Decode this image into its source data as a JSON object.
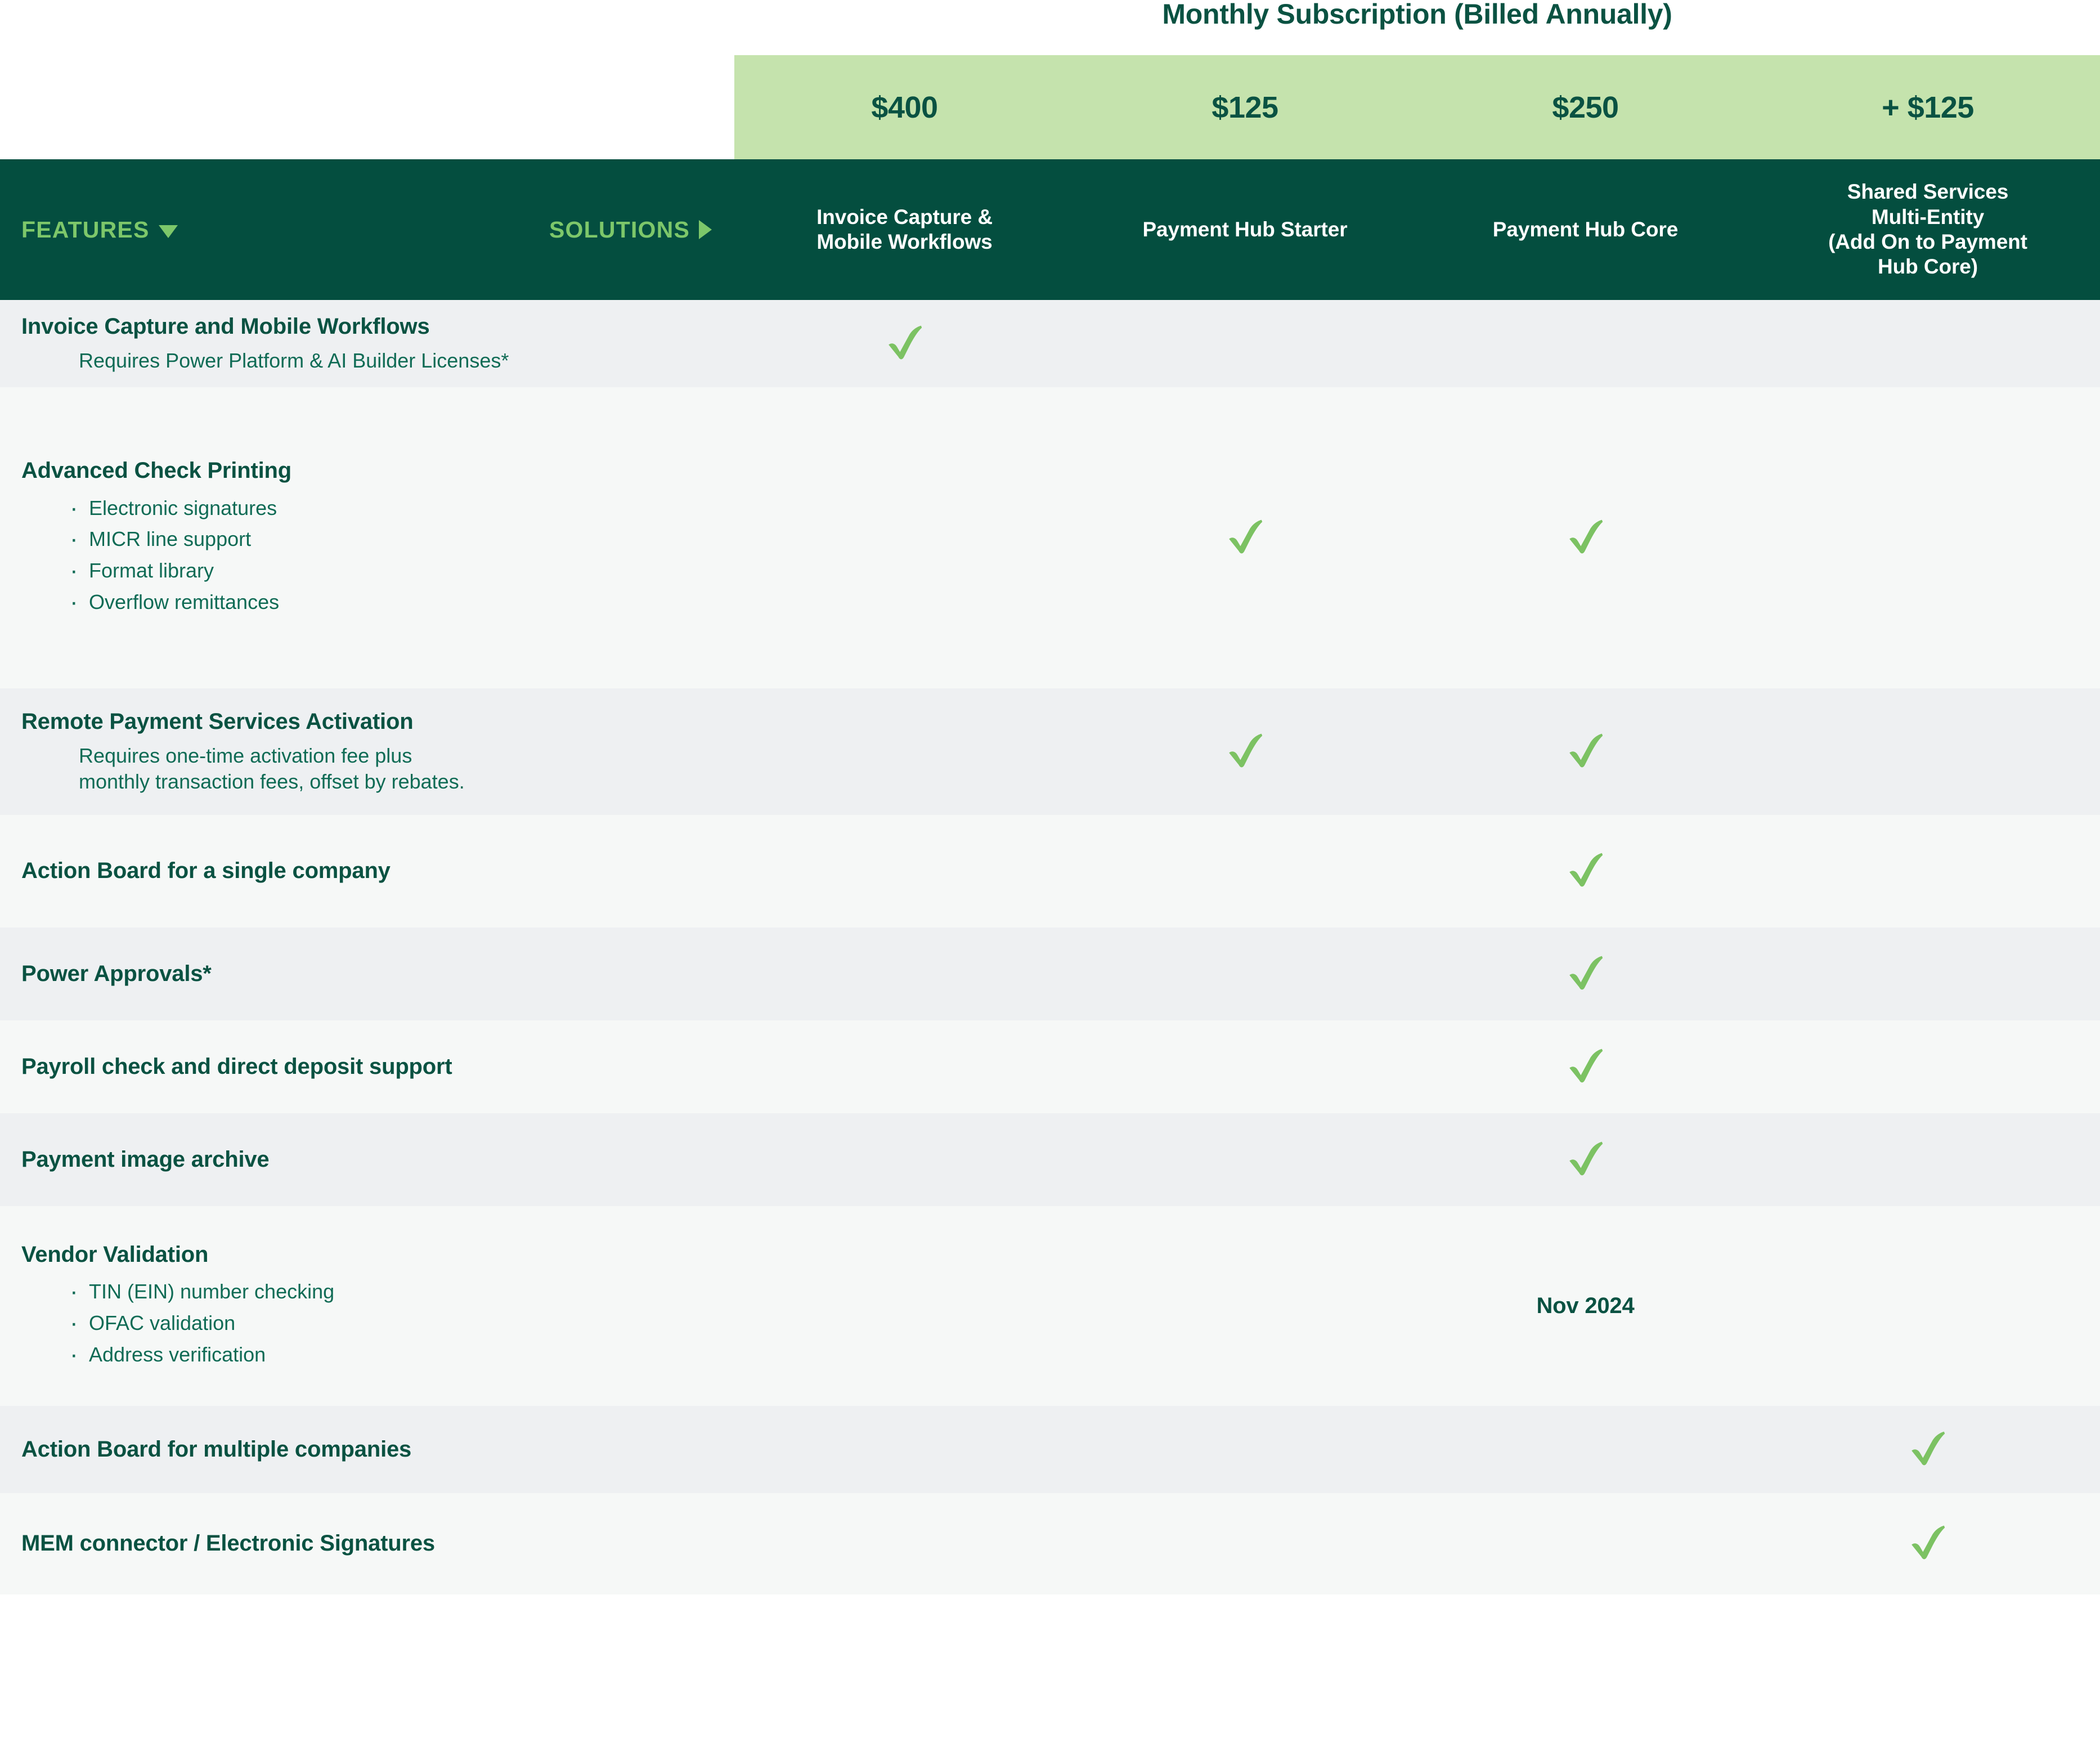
{
  "header": {
    "title": "Monthly Subscription (Billed Annually)",
    "features_label": "FEATURES",
    "solutions_label": "SOLUTIONS",
    "features_icon": "chevron-down-icon",
    "solutions_icon": "chevron-right-icon"
  },
  "colors": {
    "dark_green": "#044e3f",
    "title_green": "#0a5242",
    "light_green_band": "#c5e3ad",
    "accent_green": "#7dc76a",
    "check_green": "#7cc263",
    "row_gray": "#eef0f2",
    "row_white": "#f6f8f7"
  },
  "columns": [
    {
      "id": "invoice-capture",
      "price": "$400",
      "name": "Invoice Capture &\nMobile Workflows",
      "name_line1": "Invoice Capture &",
      "name_line2": "Mobile Workflows"
    },
    {
      "id": "payment-hub-starter",
      "price": "$125",
      "name": "Payment Hub Starter",
      "name_line1": "Payment Hub Starter",
      "name_line2": ""
    },
    {
      "id": "payment-hub-core",
      "price": "$250",
      "name": "Payment Hub Core",
      "name_line1": "Payment Hub Core",
      "name_line2": ""
    },
    {
      "id": "shared-services-multi-entity",
      "price": "+ $125",
      "name": "Shared Services Multi-Entity (Add On to Payment Hub Core)",
      "name_line1": "Shared Services",
      "name_line2": "Multi-Entity",
      "name_line3": "(Add On to Payment",
      "name_line4": "Hub Core)"
    }
  ],
  "rows": [
    {
      "id": "invoice-capture-and-mobile-workflows",
      "title": "Invoice Capture and Mobile Workflows",
      "note": "Requires Power Platform & AI Builder Licenses*",
      "bullets": [],
      "marks": [
        "check",
        "",
        "",
        ""
      ]
    },
    {
      "id": "advanced-check-printing",
      "title": "Advanced Check Printing",
      "note": "",
      "bullets": [
        "Electronic signatures",
        "MICR line support",
        "Format library",
        "Overflow remittances"
      ],
      "marks": [
        "",
        "check",
        "check",
        ""
      ]
    },
    {
      "id": "remote-payment-services-activation",
      "title": "Remote Payment Services Activation",
      "note": "Requires one-time activation fee plus monthly transaction fees, offset by rebates.",
      "bullets": [],
      "marks": [
        "",
        "check",
        "check",
        ""
      ]
    },
    {
      "id": "action-board-single-company",
      "title": "Action Board for a single company",
      "note": "",
      "bullets": [],
      "marks": [
        "",
        "",
        "check",
        ""
      ]
    },
    {
      "id": "power-approvals",
      "title": "Power Approvals*",
      "note": "",
      "bullets": [],
      "marks": [
        "",
        "",
        "check",
        ""
      ]
    },
    {
      "id": "payroll-check-direct-deposit",
      "title": "Payroll check and direct deposit support",
      "note": "",
      "bullets": [],
      "marks": [
        "",
        "",
        "check",
        ""
      ]
    },
    {
      "id": "payment-image-archive",
      "title": "Payment image archive",
      "note": "",
      "bullets": [],
      "marks": [
        "",
        "",
        "check",
        ""
      ]
    },
    {
      "id": "vendor-validation",
      "title": "Vendor Validation",
      "note": "",
      "bullets": [
        "TIN (EIN) number checking",
        "OFAC validation",
        "Address verification"
      ],
      "marks": [
        "",
        "",
        "Nov 2024",
        ""
      ]
    },
    {
      "id": "action-board-multiple-companies",
      "title": "Action Board for multiple companies",
      "note": "",
      "bullets": [],
      "marks": [
        "",
        "",
        "",
        "check"
      ]
    },
    {
      "id": "mem-connector-electronic-signatures",
      "title": "MEM connector / Electronic Signatures",
      "note": "",
      "bullets": [],
      "marks": [
        "",
        "",
        "",
        "check"
      ]
    }
  ]
}
